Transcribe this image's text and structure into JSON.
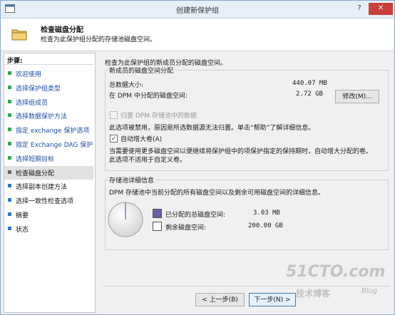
{
  "window": {
    "title": "创建新保护组",
    "help": "?",
    "close": "✕"
  },
  "header": {
    "title": "检查磁盘分配",
    "subtitle": "检查为此保护组分配的存储池磁盘空间。"
  },
  "sidebar": {
    "heading": "步骤:",
    "items": [
      {
        "label": "欢迎使用",
        "state": "done"
      },
      {
        "label": "选择保护组类型",
        "state": "done"
      },
      {
        "label": "选择组成员",
        "state": "done"
      },
      {
        "label": "选择数据保护方法",
        "state": "done"
      },
      {
        "label": "指定 exchange 保护选项",
        "state": "done"
      },
      {
        "label": "指定 Exchange DAG 保护",
        "state": "done"
      },
      {
        "label": "选择短期目标",
        "state": "done"
      },
      {
        "label": "检查磁盘分配",
        "state": "current"
      },
      {
        "label": "选择副本创建方法",
        "state": "future"
      },
      {
        "label": "选择一致性检查选项",
        "state": "future"
      },
      {
        "label": "摘要",
        "state": "future"
      },
      {
        "label": "状态",
        "state": "future"
      }
    ]
  },
  "main": {
    "intro": "检查为此保护组的新成员分配的磁盘空间。",
    "allocation": {
      "group_label": "新成员的磁盘空间分配",
      "total_label": "总数据大小:",
      "total_value": "440.07 MB",
      "dpm_label": "在 DPM 中分配的磁盘空间:",
      "dpm_value": "2.72 GB",
      "modify_button": "修改(M)...",
      "colocate_label": "归置 DPM 存储池中的数据",
      "colocate_note": "此选项被禁用，原因是所选数据源无法归置。单击“帮助”了解详细信息。",
      "autogrow_label": "自动增大卷(A)",
      "autogrow_checked": true,
      "autogrow_note_1": "当需要使用更多磁盘空间以便继续将保护组中的项保护指定的保持期时，自动增大分配的卷。",
      "autogrow_note_2": "此选项不适用于自定义卷。"
    },
    "pool": {
      "group_label": "存储池详细信息",
      "description": "DPM 存储池中当前分配的所有磁盘空间以及剩余可用磁盘空间的详细信息。",
      "allocated_label": "已分配的总磁盘空间:",
      "allocated_value": "3.03 MB",
      "allocated_color": "#6a5fa8",
      "free_label": "剩余磁盘空间:",
      "free_value": "200.00 GB",
      "free_color": "#ffffff"
    }
  },
  "footer": {
    "back_button": "< 上一步(B)",
    "next_button": "下一步(N) >"
  },
  "watermark": {
    "main": "51CTO.com",
    "sub": "技术博客",
    "blog": "Blog"
  }
}
